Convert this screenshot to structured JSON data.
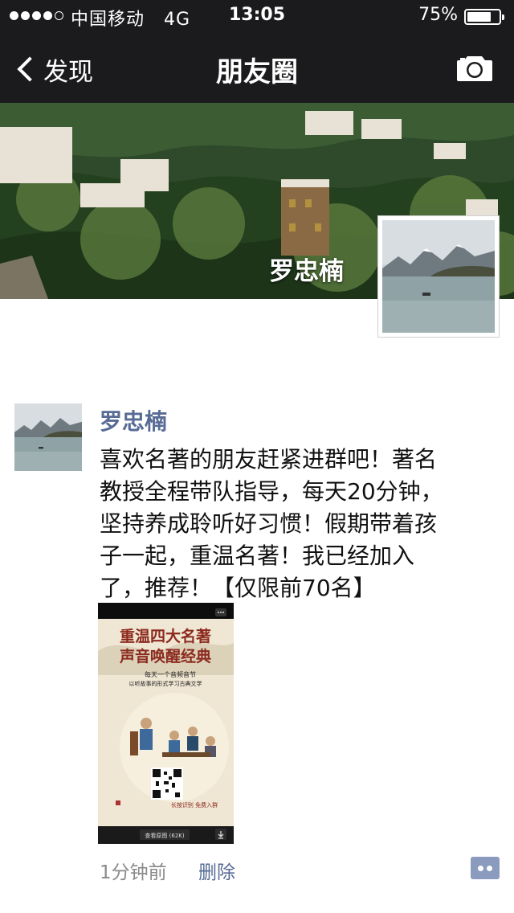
{
  "status_bar": {
    "carrier": "中国移动",
    "network": "4G",
    "time": "13:05",
    "battery_percent": "75%",
    "battery_level": 0.75
  },
  "nav": {
    "back_label": "发现",
    "title": "朋友圈",
    "camera_icon": "camera-icon"
  },
  "profile": {
    "name": "罗忠楠"
  },
  "post": {
    "author": "罗忠楠",
    "text": "喜欢名著的朋友赶紧进群吧！著名\n教授全程带队指导，每天20分钟，\n坚持养成聆听好习惯！假期带着孩\n子一起，重温名著！我已经加入\n了，推荐！【仅限前70名】",
    "image": {
      "title_line1": "重温四大名著",
      "title_line2": "声音唤醒经典",
      "subtitle_line1": "每天一个音频音节",
      "subtitle_line2": "以听故事的形式学习古典文学",
      "tagline": "长按识别 免费入群",
      "view_original": "查看原图 (62K)"
    },
    "time": "1分钟前",
    "delete_label": "删除"
  },
  "colors": {
    "nav_bg": "#1b1b1d",
    "link": "#576b95",
    "comment_button": "#8a9bbd"
  }
}
